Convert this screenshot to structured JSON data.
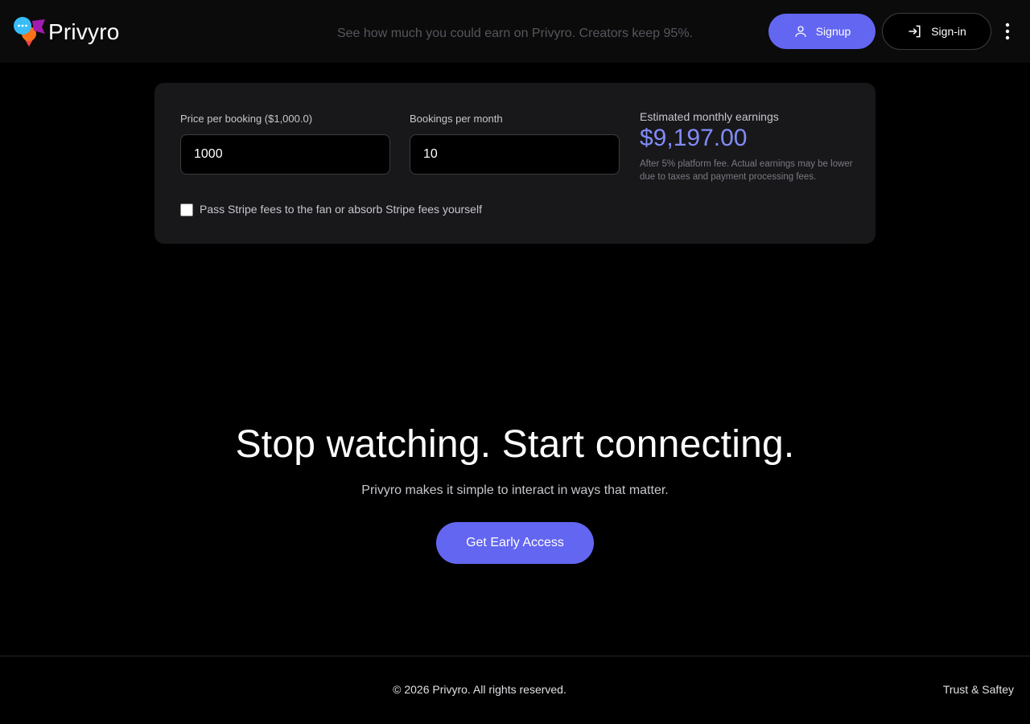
{
  "header": {
    "brand": "Privyro",
    "hero_subtitle": "See how much you could earn on Privyro. Creators keep 95%.",
    "signup_label": "Signup",
    "signin_label": "Sign-in",
    "more_icon": "more-vertical-icon"
  },
  "calculator": {
    "price_label": "Price per booking ($1,000.0)",
    "price_value": "1000",
    "bookings_label": "Bookings per month",
    "bookings_value": "10",
    "estimate_label": "Estimated monthly earnings",
    "estimate_value": "$9,197.00",
    "estimate_note": "After 5% platform fee. Actual earnings may be lower due to taxes and payment processing fees.",
    "stripe_checkbox_label": "Pass Stripe fees to the fan or absorb Stripe fees yourself",
    "stripe_checked": false
  },
  "cta": {
    "title": "Stop watching. Start connecting.",
    "subtitle": "Privyro makes it simple to interact in ways that matter.",
    "button_label": "Get Early Access"
  },
  "footer": {
    "copyright": "© 2026 Privyro. All rights reserved.",
    "trust_link": "Trust & Saftey"
  },
  "colors": {
    "accent": "#6366f1",
    "estimate": "#818cf8",
    "card_bg": "#18181b",
    "page_bg": "#000000"
  }
}
